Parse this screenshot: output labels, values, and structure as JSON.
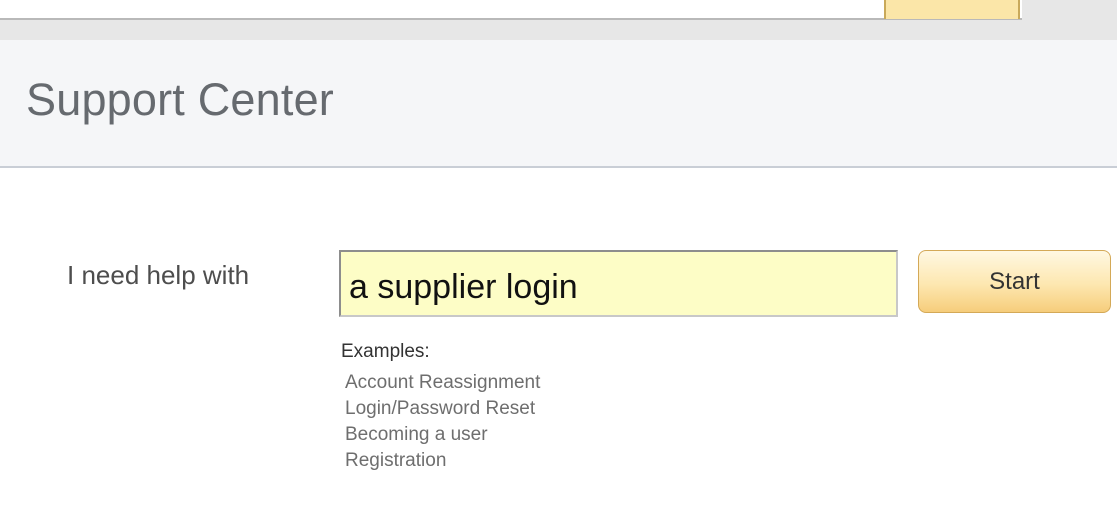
{
  "header": {
    "title": "Support Center"
  },
  "search": {
    "label": "I need help with",
    "value": "a supplier login",
    "button_label": "Start"
  },
  "examples": {
    "label": "Examples:",
    "items": [
      "Account Reassignment",
      "Login/Password Reset",
      "Becoming a user",
      "Registration"
    ]
  },
  "colors": {
    "input_background": "#fdfdc6",
    "button_gradient_top": "#fff8e2",
    "button_gradient_bottom": "#f6cd7b",
    "header_background": "#f5f6f8"
  }
}
